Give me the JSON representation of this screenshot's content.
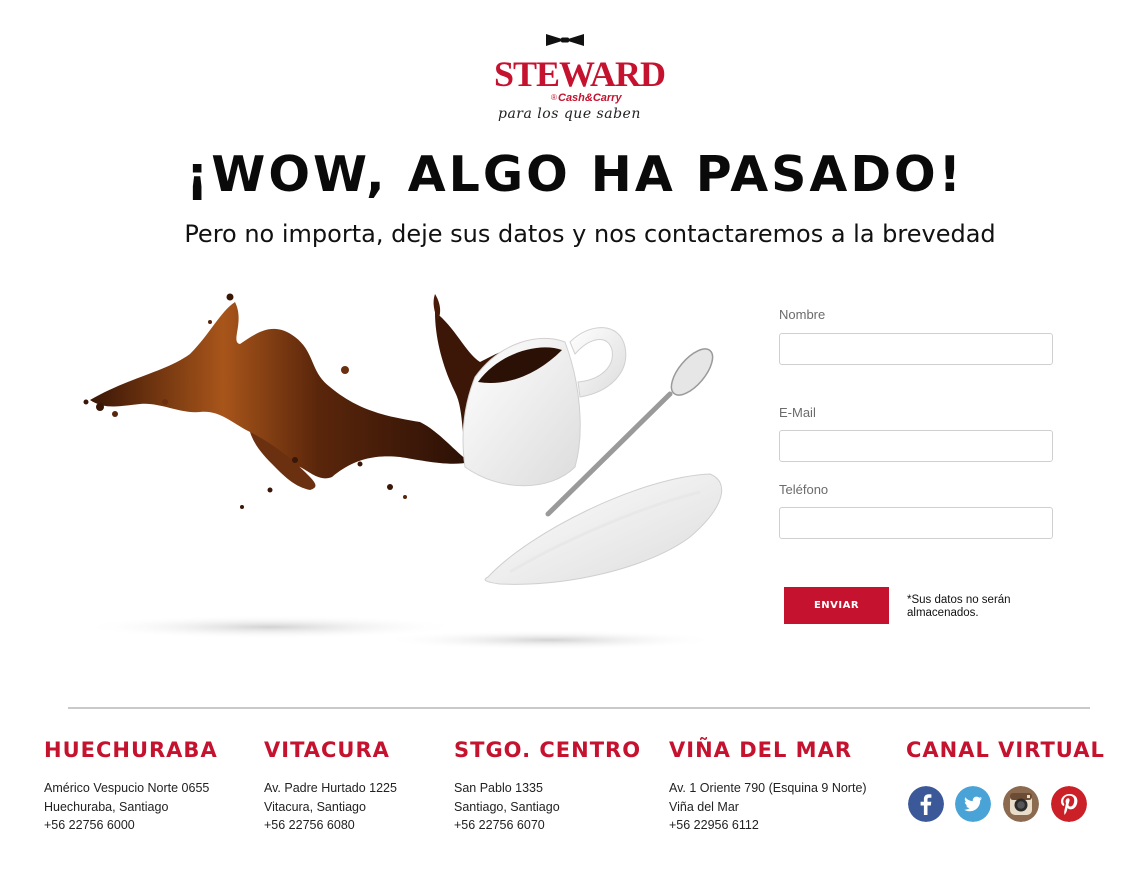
{
  "brand": {
    "name": "STEWARD",
    "subbrand": "Cash&Carry",
    "registered": "®",
    "tagline": "para los que saben",
    "color": "#c4122f"
  },
  "headline": "¡WOW, ALGO HA PASADO!",
  "subheadline": "Pero no importa, deje sus datos y nos contactaremos a la brevedad",
  "form": {
    "fields": [
      {
        "label": "Nombre",
        "value": ""
      },
      {
        "label": "E-Mail",
        "value": ""
      },
      {
        "label": "Teléfono",
        "value": ""
      }
    ],
    "submit_label": "ENVIAR",
    "disclaimer": "*Sus datos no serán almacenados."
  },
  "footer": {
    "locations": [
      {
        "name": "HUECHURABA",
        "lines": [
          "Américo Vespucio Norte 0655",
          "Huechuraba, Santiago",
          "+56 22756 6000"
        ]
      },
      {
        "name": "VITACURA",
        "lines": [
          "Av. Padre Hurtado 1225",
          "Vitacura, Santiago",
          "+56 22756 6080"
        ]
      },
      {
        "name": "STGO. CENTRO",
        "lines": [
          "San Pablo 1335",
          "Santiago, Santiago",
          "+56 22756 6070"
        ]
      },
      {
        "name": "VIÑA DEL MAR",
        "lines": [
          "Av. 1 Oriente 790 (Esquina 9 Norte)",
          "Viña del Mar",
          "+56 22956 6112"
        ]
      }
    ],
    "virtual": {
      "title": "CANAL VIRTUAL",
      "icons": [
        "facebook-icon",
        "twitter-icon",
        "instagram-icon",
        "pinterest-icon"
      ]
    }
  }
}
